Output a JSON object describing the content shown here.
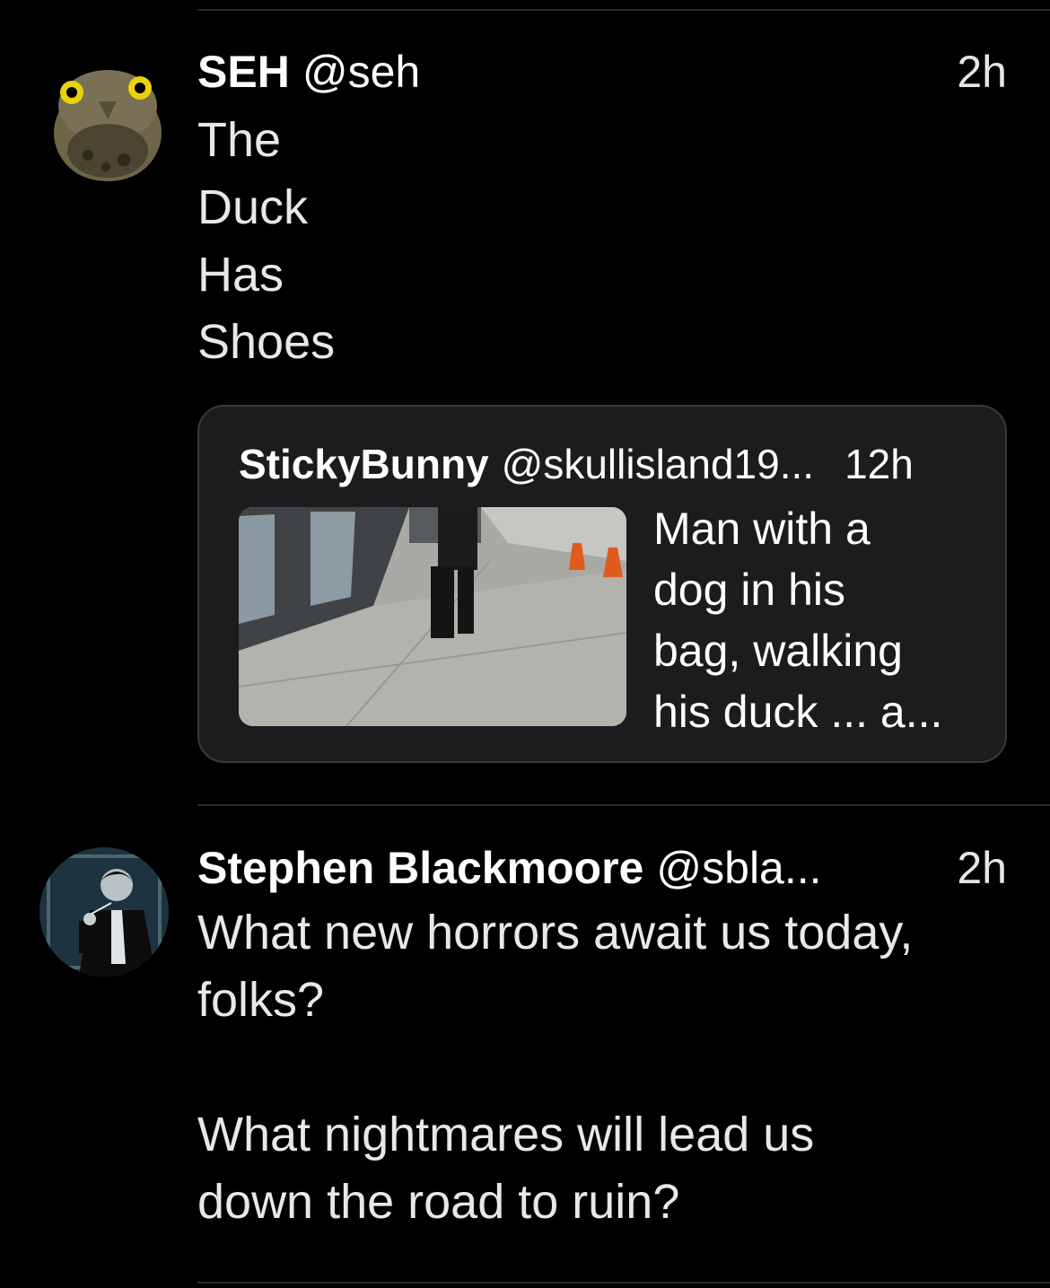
{
  "timeline": {
    "tweets": [
      {
        "name": "SEH",
        "handle": "@seh",
        "time": "2h",
        "text": "The\nDuck\nHas\nShoes",
        "avatar_icon": "owl-avatar-icon",
        "quote": {
          "name": "StickyBunny",
          "handle": "@skullisland19...",
          "time": "12h",
          "text": "Man with a\ndog in his\nbag, walking\nhis duck ... a...",
          "image_icon": "sidewalk-photo"
        }
      },
      {
        "name": "Stephen Blackmoore",
        "handle": "@sbla...",
        "time": "2h",
        "text": "What new horrors await us today,\nfolks?\n\nWhat nightmares will lead us\ndown the road to ruin?",
        "avatar_icon": "man-in-suit-avatar-icon"
      }
    ]
  },
  "colors": {
    "background": "#000000",
    "card": "#1c1c1e",
    "divider": "#2a2a2c",
    "text": "#ffffff"
  }
}
